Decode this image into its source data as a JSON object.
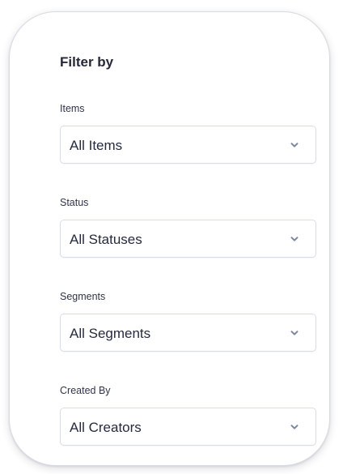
{
  "filter_panel": {
    "title": "Filter by",
    "fields": [
      {
        "label": "Items",
        "selected": "All Items"
      },
      {
        "label": "Status",
        "selected": "All Statuses"
      },
      {
        "label": "Segments",
        "selected": "All Segments"
      },
      {
        "label": "Created By",
        "selected": "All Creators"
      }
    ]
  },
  "icons": {
    "dropdown": "chevron-down-icon"
  },
  "colors": {
    "text": "#262a3d",
    "label": "#30344a",
    "border": "#d7ddea",
    "card_border": "#d9dbe2",
    "chevron": "#7d879e"
  }
}
